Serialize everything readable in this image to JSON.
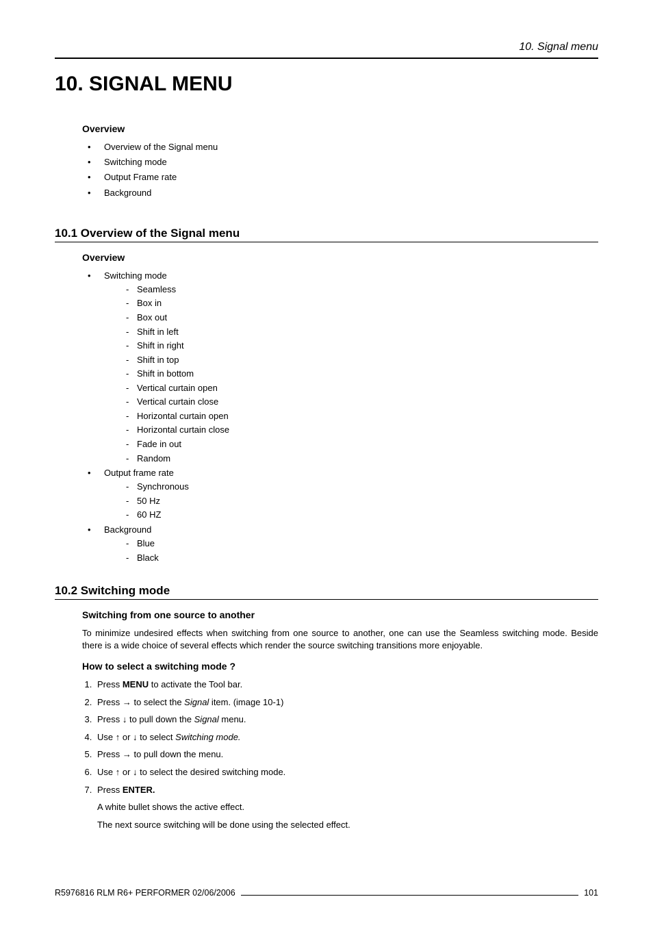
{
  "header": {
    "running": "10.  Signal menu",
    "title": "10. SIGNAL MENU"
  },
  "overview1": {
    "heading": "Overview",
    "items": [
      "Overview of the Signal menu",
      "Switching mode",
      "Output Frame rate",
      "Background"
    ]
  },
  "section101": {
    "heading": "10.1  Overview of the Signal menu",
    "subheading": "Overview",
    "groups": [
      {
        "label": "Switching mode",
        "items": [
          "Seamless",
          "Box in",
          "Box out",
          "Shift in left",
          "Shift in right",
          "Shift in top",
          "Shift in bottom",
          "Vertical curtain open",
          "Vertical curtain close",
          "Horizontal curtain open",
          "Horizontal curtain close",
          "Fade in out",
          "Random"
        ]
      },
      {
        "label": "Output frame rate",
        "items": [
          "Synchronous",
          "50 Hz",
          "60 HZ"
        ]
      },
      {
        "label": "Background",
        "items": [
          "Blue",
          "Black"
        ]
      }
    ]
  },
  "section102": {
    "heading": "10.2  Switching mode",
    "sub1": "Switching from one source to another",
    "para1": "To minimize undesired effects when switching from one source to another, one can use the Seamless switching mode.  Beside there is a wide choice of several effects which render the source switching transitions more enjoyable.",
    "sub2": "How to select a switching mode ?",
    "steps": {
      "s1a": "Press ",
      "s1b": "MENU",
      "s1c": " to activate the Tool bar.",
      "s2a": "Press → to select the ",
      "s2b": "Signal",
      "s2c": " item.  (image 10-1)",
      "s3a": "Press ↓ to pull down the ",
      "s3b": "Signal",
      "s3c": " menu.",
      "s4a": "Use ↑ or ↓ to select ",
      "s4b": "Switching mode.",
      "s5": "Press → to pull down the menu.",
      "s6": "Use ↑ or ↓ to select the desired switching mode.",
      "s7a": "Press ",
      "s7b": "ENTER."
    },
    "note1": "A white bullet shows the active effect.",
    "note2": "The next source switching will be done using the selected effect."
  },
  "footer": {
    "left": "R5976816  RLM R6+ PERFORMER  02/06/2006",
    "right": "101"
  }
}
